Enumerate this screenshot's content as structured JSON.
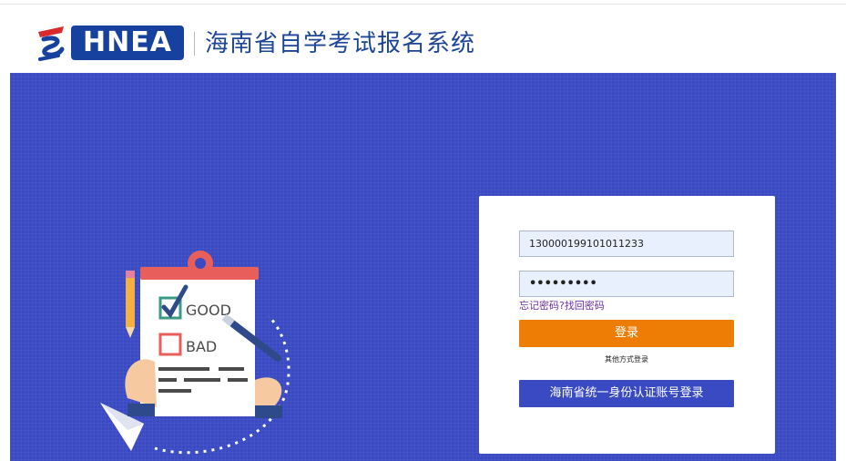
{
  "header": {
    "logo_text": "HNEA",
    "site_title": "海南省自学考试报名系统"
  },
  "illustration": {
    "good_label": "GOOD",
    "bad_label": "BAD"
  },
  "login": {
    "username_value": "130000199101011233",
    "password_value": "•••••••••",
    "forgot_link": "忘记密码?找回密码",
    "login_button": "登录",
    "other_methods": "其他方式登录",
    "id_login_button": "海南省统一身份认证账号登录"
  },
  "colors": {
    "banner_bg": "#3a4ac2",
    "logo_blue": "#17419e",
    "login_orange": "#ee7d06",
    "logo_red": "#d9292c"
  }
}
